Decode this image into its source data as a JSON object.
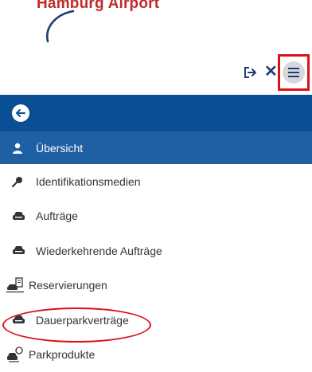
{
  "header": {
    "logo_text": "Hamburg Airport"
  },
  "toolbar": {
    "logout_icon": "logout-icon",
    "close_icon": "close-icon",
    "close_glyph": "✕",
    "menu_icon": "hamburger-menu-icon"
  },
  "back": {
    "icon": "arrow-left-icon"
  },
  "menu": {
    "items": [
      {
        "label": "Übersicht",
        "icon": "user-icon",
        "active": true
      },
      {
        "label": "Identifikationsmedien",
        "icon": "key-icon",
        "active": false
      },
      {
        "label": "Aufträge",
        "icon": "car-icon",
        "active": false
      },
      {
        "label": "Wiederkehrende Aufträge",
        "icon": "car-icon",
        "active": false
      },
      {
        "label": "Reservierungen",
        "icon": "car-document-icon",
        "active": false
      },
      {
        "label": "Dauerparkverträge",
        "icon": "car-icon",
        "active": false
      },
      {
        "label": "Parkprodukte",
        "icon": "car-badge-icon",
        "active": false
      }
    ]
  },
  "colors": {
    "header_blue": "#0a4e93",
    "active_blue": "#1f5fa3",
    "annotation_red": "#d9131a"
  }
}
